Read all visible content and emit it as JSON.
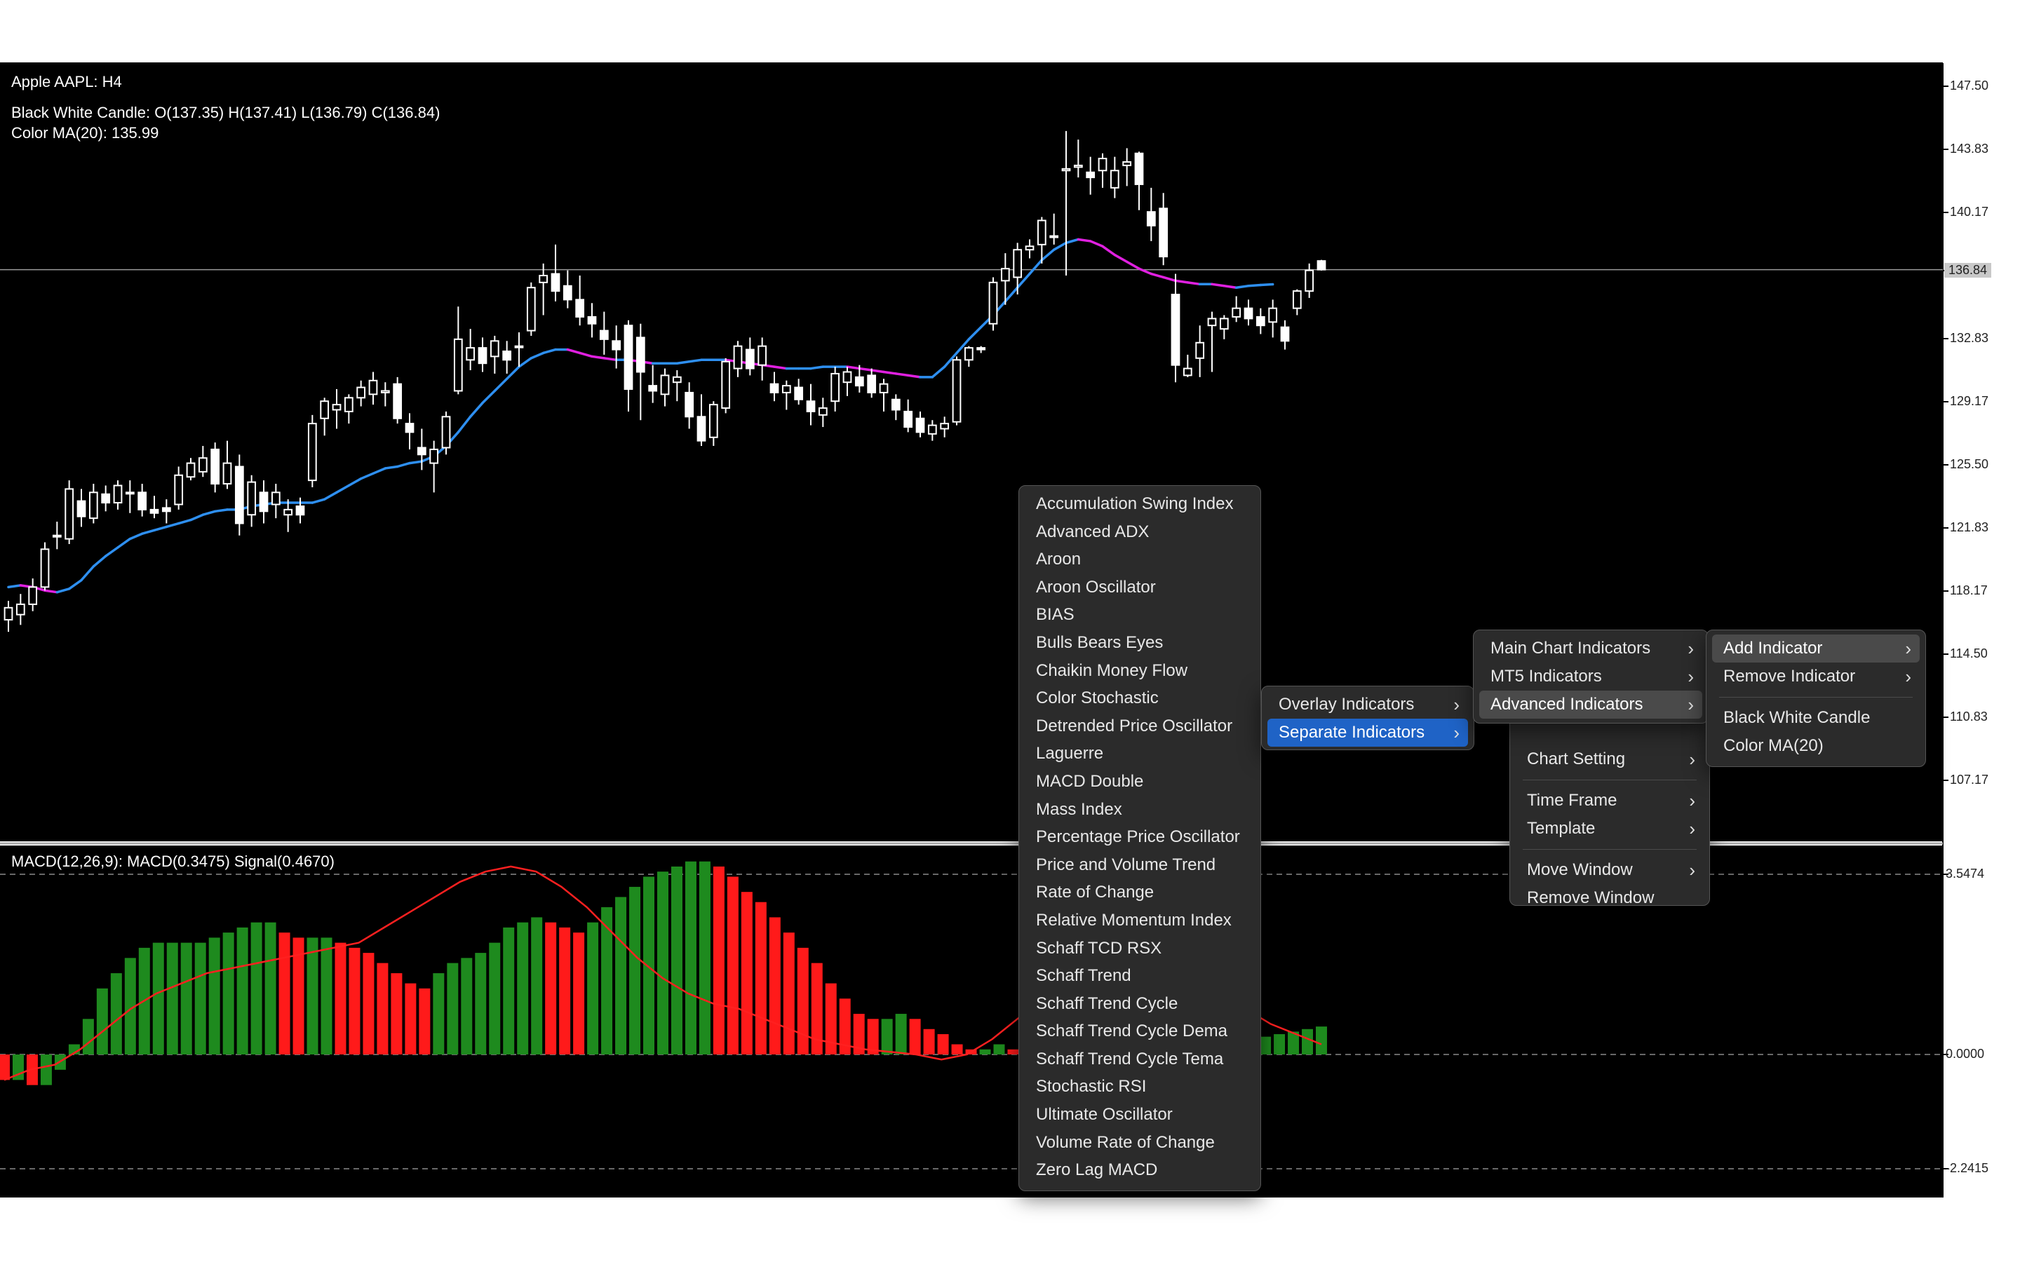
{
  "chart_header": {
    "symbol_line": "Apple AAPL: H4",
    "candle_info": "Black White Candle: O(137.35) H(137.41) L(136.79) C(136.84)",
    "ma_info": "Color MA(20): 135.99",
    "macd_info": "MACD(12,26,9): MACD(0.3475) Signal(0.4670)"
  },
  "price_axis": {
    "labels": [
      "147.50",
      "143.83",
      "140.17",
      "136.84",
      "132.83",
      "129.17",
      "125.50",
      "121.83",
      "118.17",
      "114.50",
      "110.83",
      "107.17"
    ],
    "current_price": "136.84"
  },
  "macd_axis": {
    "labels": [
      "3.5474",
      "0.0000",
      "-2.2415"
    ]
  },
  "colors": {
    "background": "#000000",
    "candle": "#ffffff",
    "ma_up": "#2e8ff0",
    "ma_down": "#e020e0",
    "hist_up": "#1e8a1e",
    "hist_down": "#ff1a1a",
    "signal": "#ff2020",
    "menu_bg": "#2b2b2b",
    "highlight": "#1f63c6"
  },
  "menus": {
    "indicator_list": [
      "Accumulation Swing Index",
      "Advanced ADX",
      "Aroon",
      "Aroon Oscillator",
      "BIAS",
      "Bulls Bears Eyes",
      "Chaikin Money Flow",
      "Color Stochastic",
      "Detrended Price Oscillator",
      "Laguerre",
      "MACD Double",
      "Mass Index",
      "Percentage Price Oscillator",
      "Price and Volume Trend",
      "Rate of Change",
      "Relative Momentum Index",
      "Schaff TCD RSX",
      "Schaff Trend",
      "Schaff Trend Cycle",
      "Schaff Trend Cycle Dema",
      "Schaff Trend Cycle Tema",
      "Stochastic RSI",
      "Ultimate Oscillator",
      "Volume Rate of Change",
      "Zero Lag MACD"
    ],
    "category": {
      "overlay": "Overlay Indicators",
      "separate": "Separate Indicators"
    },
    "indicator_sources": {
      "main_chart": "Main Chart Indicators",
      "mt5": "MT5 Indicators",
      "advanced": "Advanced Indicators"
    },
    "context": {
      "chart_setting": "Chart Setting",
      "time_frame": "Time Frame",
      "template": "Template",
      "move_window": "Move Window",
      "remove_window": "Remove Window"
    },
    "indicator_actions": {
      "add": "Add Indicator",
      "remove": "Remove Indicator",
      "black_white_candle": "Black White Candle",
      "color_ma": "Color MA(20)"
    }
  },
  "chart_data": {
    "type": "candlestick",
    "symbol": "Apple AAPL",
    "timeframe": "H4",
    "ylim": [
      105.0,
      149.0
    ],
    "last_close": 136.84,
    "candles": [
      [
        116.5,
        117.6,
        115.8,
        117.2
      ],
      [
        116.8,
        118.0,
        116.2,
        117.4
      ],
      [
        117.4,
        118.9,
        117.0,
        118.4
      ],
      [
        118.4,
        121.0,
        118.2,
        120.6
      ],
      [
        121.4,
        122.2,
        120.6,
        121.4
      ],
      [
        121.2,
        124.6,
        120.9,
        124.1
      ],
      [
        123.4,
        124.1,
        121.9,
        122.5
      ],
      [
        122.4,
        124.4,
        122.1,
        123.9
      ],
      [
        123.8,
        124.3,
        122.8,
        123.3
      ],
      [
        123.3,
        124.6,
        122.9,
        124.3
      ],
      [
        123.9,
        124.6,
        122.7,
        123.9
      ],
      [
        123.9,
        124.4,
        122.5,
        122.9
      ],
      [
        122.9,
        123.7,
        122.4,
        122.7
      ],
      [
        123.0,
        123.5,
        122.1,
        122.8
      ],
      [
        123.2,
        125.4,
        122.9,
        124.9
      ],
      [
        124.8,
        125.9,
        124.6,
        125.6
      ],
      [
        125.1,
        126.6,
        124.8,
        125.9
      ],
      [
        126.4,
        126.8,
        123.9,
        124.4
      ],
      [
        124.4,
        126.9,
        124.1,
        125.6
      ],
      [
        125.4,
        126.1,
        121.4,
        122.1
      ],
      [
        122.6,
        124.9,
        121.9,
        124.5
      ],
      [
        123.9,
        124.6,
        122.1,
        122.8
      ],
      [
        123.2,
        124.4,
        122.4,
        123.9
      ],
      [
        122.6,
        123.5,
        121.6,
        122.9
      ],
      [
        123.1,
        123.6,
        122.1,
        122.6
      ],
      [
        124.6,
        128.4,
        124.2,
        127.9
      ],
      [
        128.2,
        129.4,
        127.2,
        129.2
      ],
      [
        128.7,
        129.9,
        127.6,
        129.0
      ],
      [
        128.6,
        129.6,
        127.9,
        129.4
      ],
      [
        129.4,
        130.4,
        128.9,
        130.0
      ],
      [
        129.6,
        130.9,
        129.0,
        130.4
      ],
      [
        129.7,
        130.3,
        128.9,
        129.8
      ],
      [
        130.2,
        130.6,
        127.9,
        128.2
      ],
      [
        127.9,
        128.5,
        126.4,
        127.4
      ],
      [
        126.5,
        127.6,
        125.2,
        126.1
      ],
      [
        125.6,
        126.9,
        123.9,
        126.4
      ],
      [
        126.5,
        128.6,
        126.1,
        128.3
      ],
      [
        129.8,
        134.7,
        129.6,
        132.8
      ],
      [
        131.6,
        133.4,
        131.0,
        132.3
      ],
      [
        132.3,
        132.9,
        130.9,
        131.4
      ],
      [
        131.8,
        133.0,
        130.8,
        132.7
      ],
      [
        132.1,
        132.7,
        130.8,
        131.6
      ],
      [
        132.4,
        133.2,
        131.2,
        132.4
      ],
      [
        133.3,
        136.1,
        133.0,
        135.8
      ],
      [
        136.1,
        137.2,
        134.2,
        136.5
      ],
      [
        136.6,
        138.3,
        135.0,
        135.6
      ],
      [
        135.9,
        136.8,
        134.6,
        135.1
      ],
      [
        135.1,
        136.5,
        133.6,
        134.1
      ],
      [
        134.1,
        134.9,
        132.9,
        133.7
      ],
      [
        133.3,
        134.4,
        131.9,
        132.8
      ],
      [
        132.7,
        133.6,
        131.1,
        132.2
      ],
      [
        133.6,
        133.9,
        128.6,
        129.9
      ],
      [
        132.9,
        133.7,
        128.1,
        130.9
      ],
      [
        130.1,
        131.3,
        129.1,
        129.8
      ],
      [
        129.6,
        131.1,
        128.9,
        130.7
      ],
      [
        130.3,
        131.0,
        129.2,
        130.6
      ],
      [
        129.7,
        130.3,
        127.6,
        128.3
      ],
      [
        128.3,
        129.6,
        126.6,
        126.9
      ],
      [
        127.1,
        129.2,
        126.6,
        129.0
      ],
      [
        128.8,
        131.7,
        128.5,
        131.5
      ],
      [
        131.1,
        132.7,
        130.6,
        132.4
      ],
      [
        132.2,
        132.9,
        130.7,
        131.1
      ],
      [
        131.3,
        132.9,
        130.4,
        132.4
      ],
      [
        130.2,
        130.9,
        129.2,
        129.7
      ],
      [
        129.7,
        130.4,
        128.7,
        130.1
      ],
      [
        130.0,
        130.5,
        129.0,
        129.3
      ],
      [
        129.2,
        130.2,
        127.8,
        128.6
      ],
      [
        128.4,
        129.4,
        127.7,
        128.8
      ],
      [
        129.2,
        131.2,
        128.6,
        130.8
      ],
      [
        130.3,
        131.2,
        129.5,
        130.9
      ],
      [
        130.6,
        131.3,
        129.7,
        130.1
      ],
      [
        130.7,
        131.1,
        129.4,
        129.7
      ],
      [
        129.7,
        130.5,
        128.6,
        130.2
      ],
      [
        129.3,
        129.6,
        128.1,
        128.7
      ],
      [
        128.6,
        129.3,
        127.4,
        127.7
      ],
      [
        128.2,
        128.6,
        127.1,
        127.4
      ],
      [
        127.3,
        128.1,
        126.9,
        127.8
      ],
      [
        127.6,
        128.3,
        127.1,
        127.9
      ],
      [
        128.0,
        131.8,
        127.8,
        131.6
      ],
      [
        131.6,
        132.4,
        131.2,
        132.3
      ],
      [
        132.3,
        132.4,
        132.0,
        132.2
      ],
      [
        133.7,
        136.4,
        133.3,
        136.1
      ],
      [
        136.2,
        137.8,
        134.8,
        136.9
      ],
      [
        136.4,
        138.4,
        135.4,
        138.0
      ],
      [
        138.0,
        138.6,
        137.5,
        138.2
      ],
      [
        138.3,
        139.9,
        137.2,
        139.7
      ],
      [
        138.8,
        140.1,
        138.3,
        138.8
      ],
      [
        142.6,
        144.9,
        136.5,
        142.7
      ],
      [
        142.8,
        144.4,
        142.2,
        142.9
      ],
      [
        142.5,
        143.4,
        141.2,
        142.2
      ],
      [
        142.6,
        143.6,
        141.6,
        143.3
      ],
      [
        141.6,
        143.4,
        141.0,
        142.6
      ],
      [
        142.9,
        143.9,
        141.7,
        143.1
      ],
      [
        143.6,
        143.7,
        140.3,
        141.8
      ],
      [
        140.2,
        141.6,
        138.5,
        139.4
      ],
      [
        140.4,
        141.3,
        137.1,
        137.6
      ],
      [
        135.4,
        136.6,
        130.3,
        131.3
      ],
      [
        130.7,
        131.9,
        130.6,
        131.1
      ],
      [
        131.7,
        133.6,
        130.6,
        132.6
      ],
      [
        133.6,
        134.4,
        130.9,
        134.0
      ],
      [
        133.4,
        134.2,
        132.8,
        134.0
      ],
      [
        134.1,
        135.3,
        133.8,
        134.6
      ],
      [
        134.6,
        135.1,
        133.6,
        134.0
      ],
      [
        134.1,
        134.6,
        133.1,
        133.6
      ],
      [
        133.8,
        135.1,
        132.9,
        134.6
      ],
      [
        133.5,
        133.9,
        132.2,
        132.7
      ],
      [
        134.6,
        135.7,
        134.2,
        135.6
      ],
      [
        135.6,
        137.2,
        135.2,
        136.8
      ],
      [
        137.35,
        137.41,
        136.79,
        136.84
      ]
    ],
    "ma20": [
      118.4,
      118.5,
      118.4,
      118.2,
      118.1,
      118.3,
      118.8,
      119.6,
      120.2,
      120.7,
      121.2,
      121.5,
      121.7,
      121.9,
      122.1,
      122.3,
      122.6,
      122.8,
      122.9,
      122.9,
      123.1,
      123.2,
      123.3,
      123.3,
      123.3,
      123.3,
      123.5,
      123.9,
      124.3,
      124.7,
      125.0,
      125.3,
      125.4,
      125.6,
      125.7,
      126.0,
      126.6,
      127.4,
      128.3,
      129.1,
      129.8,
      130.5,
      131.2,
      131.7,
      132.0,
      132.2,
      132.2,
      132.0,
      131.8,
      131.7,
      131.6,
      131.6,
      131.5,
      131.4,
      131.4,
      131.4,
      131.5,
      131.6,
      131.6,
      131.6,
      131.5,
      131.4,
      131.3,
      131.2,
      131.1,
      131.1,
      131.1,
      131.2,
      131.2,
      131.2,
      131.1,
      131.0,
      130.9,
      130.8,
      130.7,
      130.6,
      130.6,
      131.2,
      132.0,
      132.8,
      133.5,
      134.2,
      135.0,
      135.8,
      136.6,
      137.4,
      138.0,
      138.4,
      138.6,
      138.5,
      138.2,
      137.7,
      137.3,
      136.9,
      136.6,
      136.4,
      136.2,
      136.1,
      136.0,
      136.0,
      135.9,
      135.8,
      135.9,
      135.95,
      135.99
    ],
    "macd": {
      "ylim": [
        -2.2415,
        3.5474
      ],
      "histogram": [
        -0.5,
        -0.5,
        -0.6,
        -0.6,
        -0.3,
        0.2,
        0.7,
        1.3,
        1.6,
        1.9,
        2.1,
        2.2,
        2.2,
        2.2,
        2.2,
        2.3,
        2.4,
        2.5,
        2.6,
        2.6,
        2.4,
        2.3,
        2.3,
        2.3,
        2.2,
        2.1,
        2.0,
        1.8,
        1.6,
        1.4,
        1.3,
        1.6,
        1.8,
        1.9,
        2.0,
        2.2,
        2.5,
        2.6,
        2.7,
        2.6,
        2.5,
        2.4,
        2.6,
        2.9,
        3.1,
        3.3,
        3.5,
        3.6,
        3.7,
        3.8,
        3.8,
        3.7,
        3.5,
        3.2,
        3.0,
        2.7,
        2.4,
        2.1,
        1.8,
        1.4,
        1.1,
        0.8,
        0.7,
        0.7,
        0.8,
        0.7,
        0.5,
        0.4,
        0.2,
        0.1,
        0.1,
        0.2,
        0.1,
        -0.1,
        -0.2,
        -0.4,
        -0.5,
        -0.6,
        -0.3,
        0.3,
        1.0,
        1.5,
        1.8,
        2.1,
        2.0,
        1.6,
        1.1,
        0.6,
        0.4,
        0.3,
        0.35,
        0.4,
        0.45,
        0.5,
        0.55
      ],
      "signal": [
        -0.5,
        -0.3,
        -0.2,
        0.1,
        0.5,
        0.9,
        1.2,
        1.4,
        1.6,
        1.7,
        1.8,
        1.9,
        2.0,
        2.1,
        2.2,
        2.5,
        2.8,
        3.1,
        3.4,
        3.6,
        3.7,
        3.6,
        3.3,
        2.9,
        2.4,
        1.9,
        1.5,
        1.2,
        1.0,
        0.9,
        0.7,
        0.5,
        0.3,
        0.2,
        0.1,
        0.05,
        0.0,
        -0.1,
        0.0,
        0.3,
        0.7,
        1.1,
        1.5,
        1.9,
        2.2,
        2.3,
        2.0,
        1.6,
        1.2,
        0.9,
        0.6,
        0.4,
        0.2
      ]
    }
  }
}
